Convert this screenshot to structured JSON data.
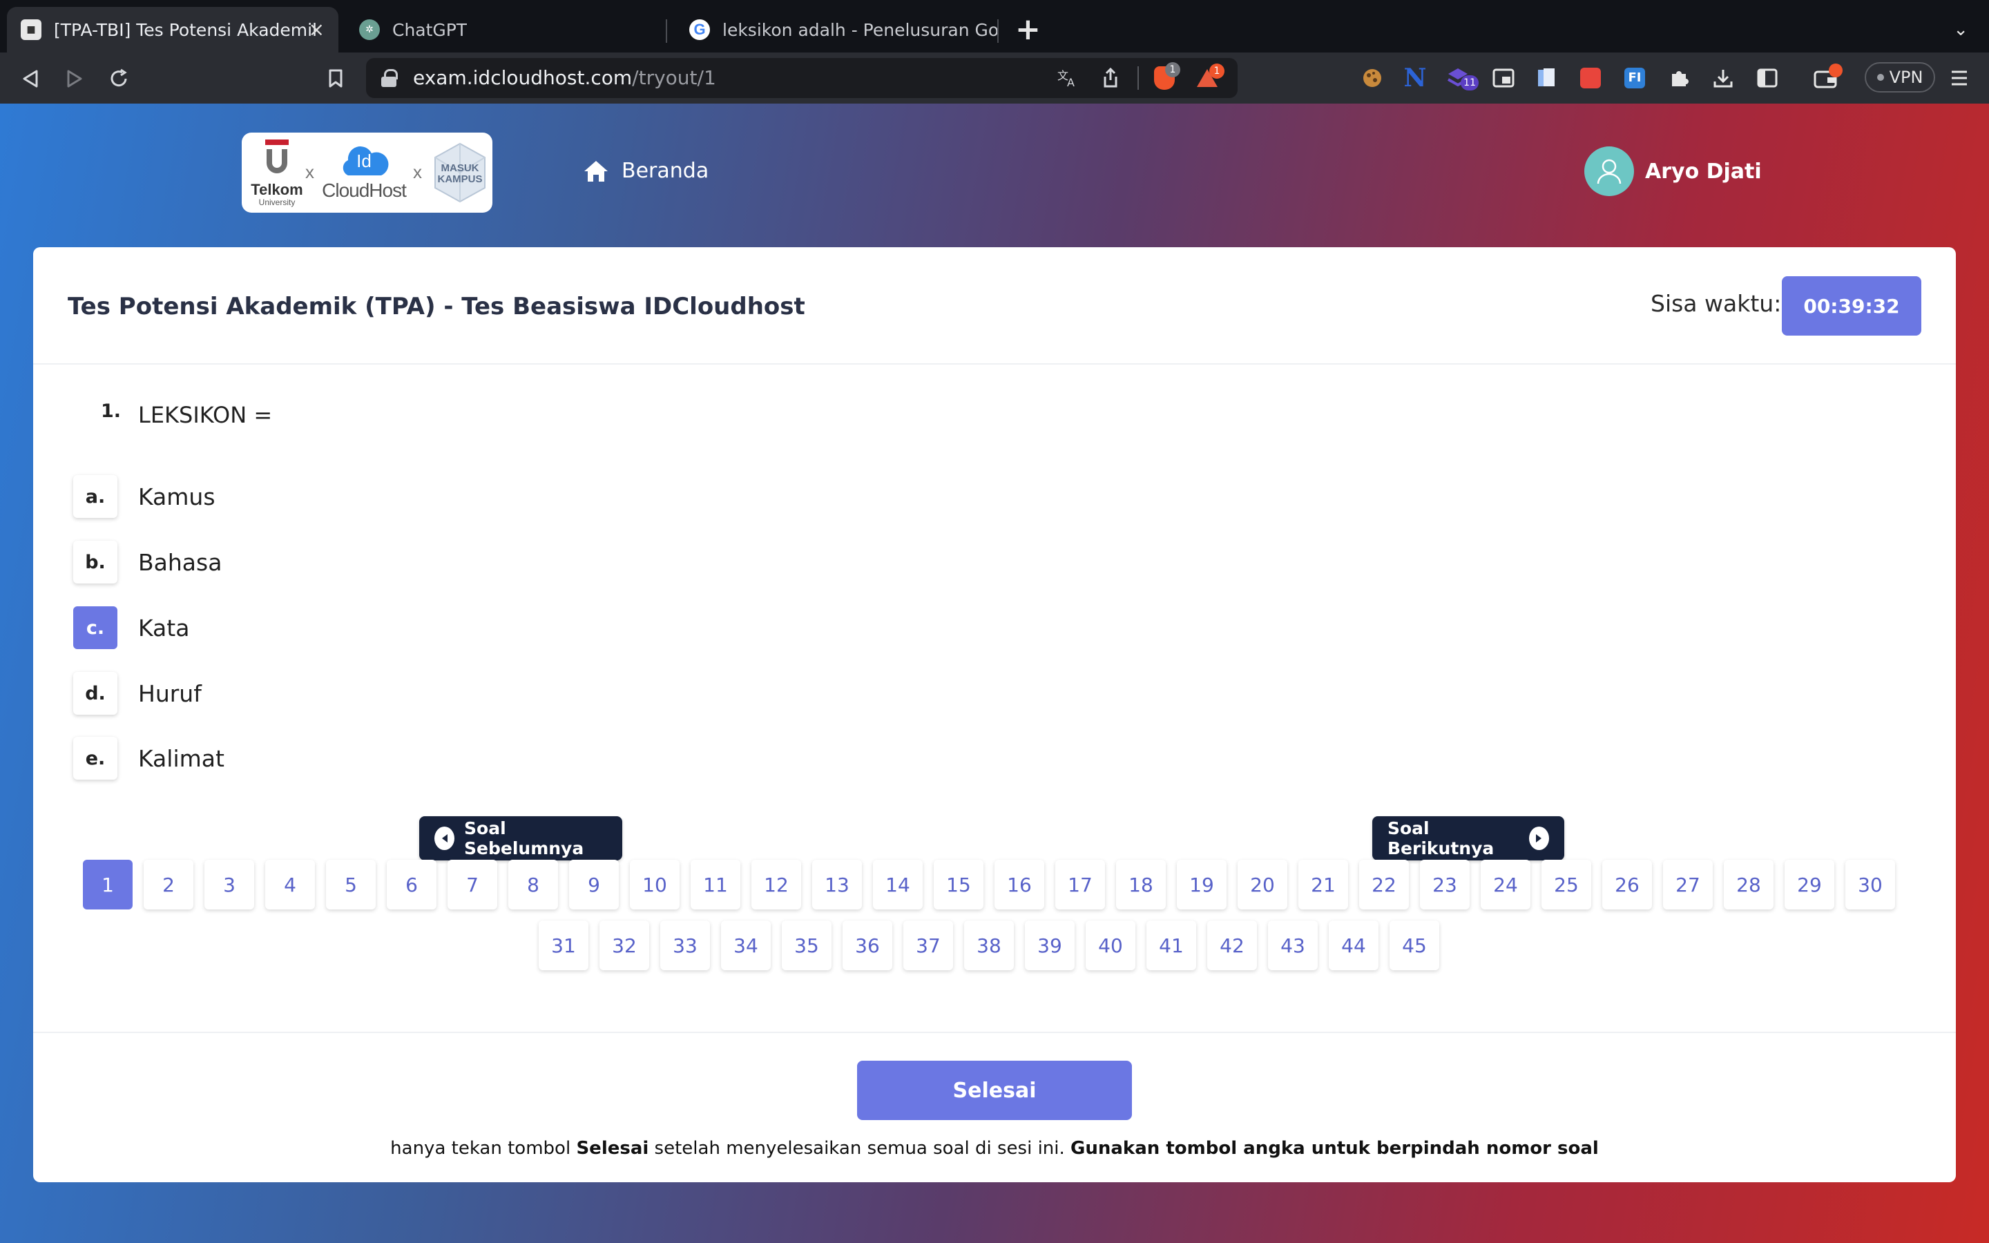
{
  "browser": {
    "tabs": [
      {
        "title": "[TPA-TBI] Tes Potensi Akademik",
        "active": true
      },
      {
        "title": "ChatGPT",
        "active": false
      },
      {
        "title": "leksikon adalh - Penelusuran Google",
        "active": false
      }
    ],
    "url_host": "exam.idcloudhost.com",
    "url_path": "/tryout/1",
    "brave_badge": "1",
    "rewards_badge": "1",
    "ext_badge": "11",
    "vpn_label": "VPN"
  },
  "header": {
    "logo_telkom": "Telkom",
    "logo_telkom_sub": "University",
    "logo_x": "x",
    "logo_id": "Id",
    "logo_cloudhost": "CloudHost",
    "logo_masuk": "MASUK KAMPUS",
    "nav_home": "Beranda",
    "user_name": "Aryo Djati"
  },
  "exam": {
    "title": "Tes Potensi Akademik (TPA) - Tes Beasiswa IDCloudhost",
    "timer_label": "Sisa waktu:",
    "timer_value": "00:39:32",
    "question_number": "1.",
    "question_text": "LEKSIKON =",
    "options": [
      {
        "letter": "a.",
        "text": "Kamus"
      },
      {
        "letter": "b.",
        "text": "Bahasa"
      },
      {
        "letter": "c.",
        "text": "Kata"
      },
      {
        "letter": "d.",
        "text": "Huruf"
      },
      {
        "letter": "e.",
        "text": "Kalimat"
      }
    ],
    "selected_option": "c.",
    "prev_label": "Soal Sebelumnya",
    "next_label": "Soal Berikutnya",
    "question_buttons": [
      "1",
      "2",
      "3",
      "4",
      "5",
      "6",
      "7",
      "8",
      "9",
      "10",
      "11",
      "12",
      "13",
      "14",
      "15",
      "16",
      "17",
      "18",
      "19",
      "20",
      "21",
      "22",
      "23",
      "24",
      "25",
      "26",
      "27",
      "28",
      "29",
      "30",
      "31",
      "32",
      "33",
      "34",
      "35",
      "36",
      "37",
      "38",
      "39",
      "40",
      "41",
      "42",
      "43",
      "44",
      "45"
    ],
    "current_question": "1",
    "finish_label": "Selesai",
    "note_part1": "hanya tekan tombol ",
    "note_bold1": "Selesai",
    "note_part2": " setelah menyelesaikan semua soal di sesi ini. ",
    "note_bold2": "Gunakan tombol angka untuk berpindah nomor soal"
  },
  "colors": {
    "accent": "#6b77e3",
    "dark_button": "#17223b",
    "number_text": "#5862c9"
  }
}
